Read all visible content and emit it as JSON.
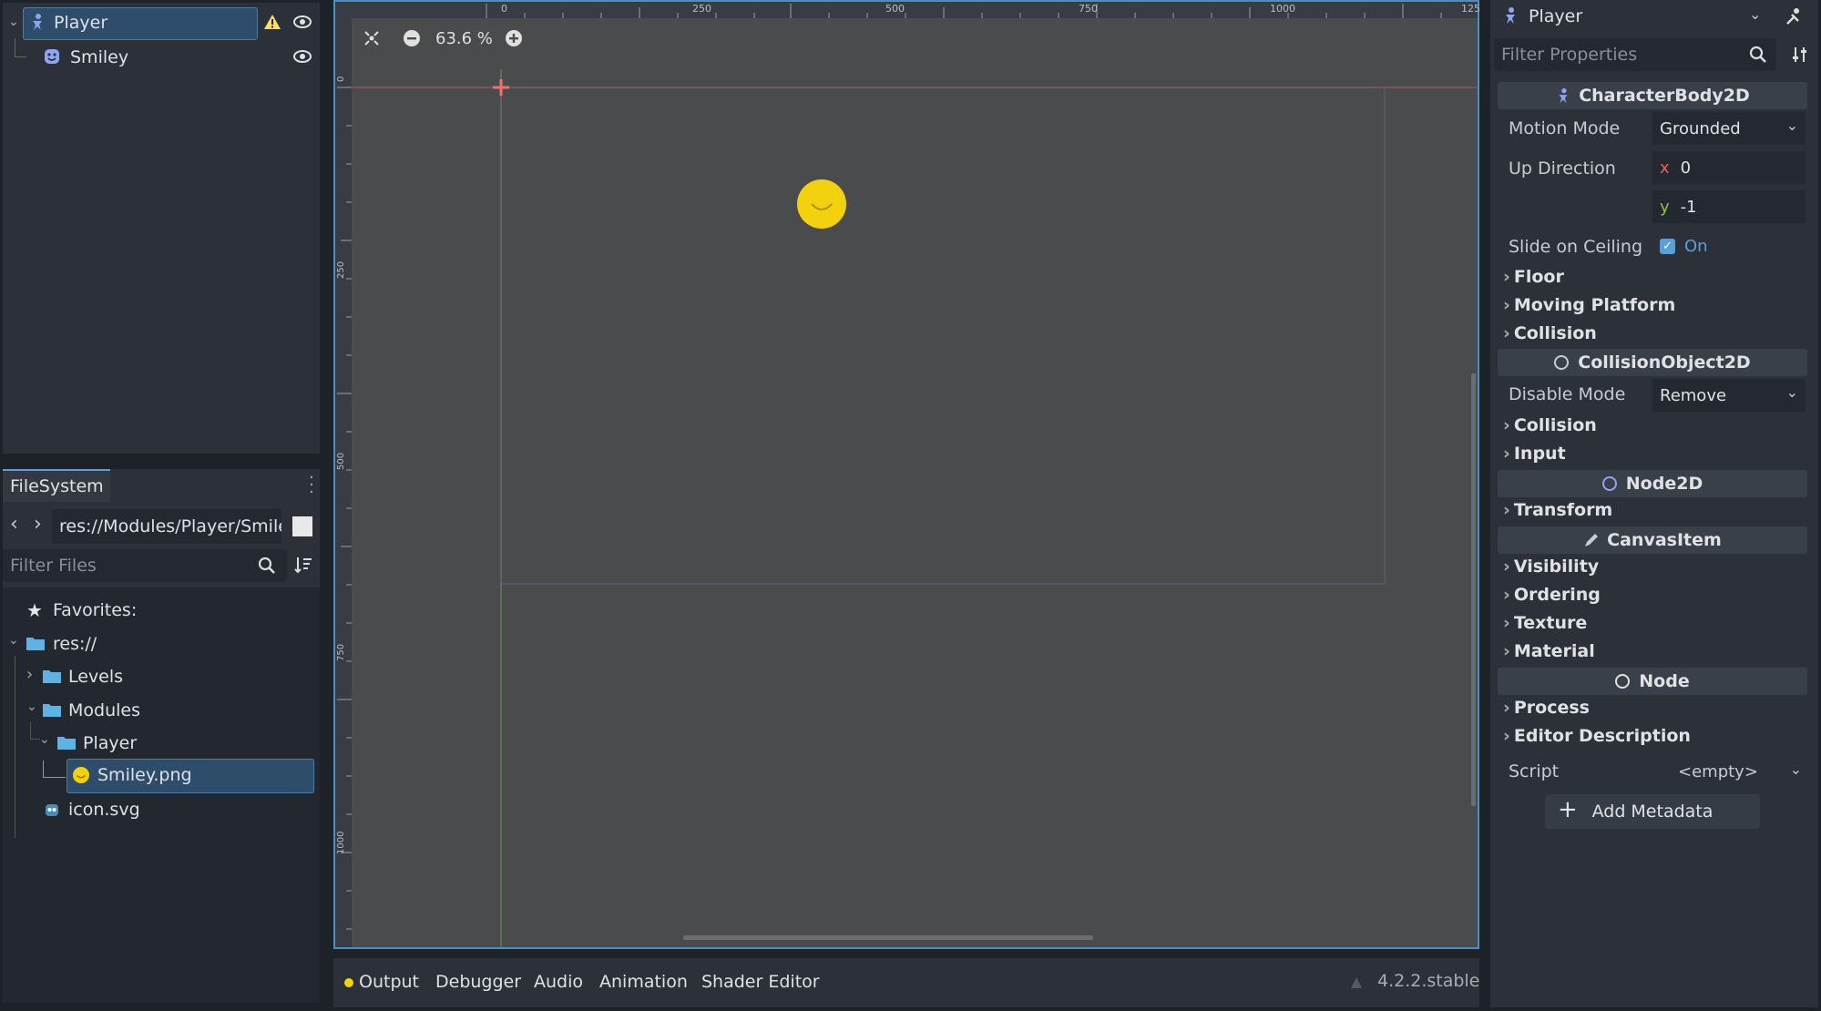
{
  "scene_tree": {
    "items": [
      {
        "label": "Player"
      },
      {
        "label": "Smiley"
      }
    ]
  },
  "filesystem": {
    "tab_label": "FileSystem",
    "path": "res://Modules/Player/Smile",
    "filter_placeholder": "Filter Files",
    "items": [
      {
        "label": "Favorites:"
      },
      {
        "label": "res://"
      },
      {
        "label": "Levels"
      },
      {
        "label": "Modules"
      },
      {
        "label": "Player"
      },
      {
        "label": "Smiley.png"
      },
      {
        "label": "icon.svg"
      }
    ]
  },
  "viewport": {
    "zoom": "63.6 %",
    "ruler_top": [
      "0",
      "250",
      "500",
      "750",
      "1000",
      "125"
    ],
    "ruler_left": [
      "0",
      "250",
      "500",
      "750",
      "1000"
    ]
  },
  "bottom_panel": {
    "tabs": [
      "Output",
      "Debugger",
      "Audio",
      "Animation",
      "Shader Editor"
    ],
    "version": "4.2.2.stable"
  },
  "inspector": {
    "node_name": "Player",
    "filter_placeholder": "Filter Properties",
    "sections": {
      "character_body": "CharacterBody2D",
      "collision_object": "CollisionObject2D",
      "node2d": "Node2D",
      "canvas_item": "CanvasItem",
      "node": "Node"
    },
    "motion_mode": {
      "label": "Motion Mode",
      "value": "Grounded"
    },
    "up_direction": {
      "label": "Up Direction",
      "x_label": "x",
      "x": "0",
      "y_label": "y",
      "y": "-1"
    },
    "slide_on_ceiling": {
      "label": "Slide on Ceiling",
      "value": "On"
    },
    "groups_cb": [
      "Floor",
      "Moving Platform",
      "Collision"
    ],
    "disable_mode": {
      "label": "Disable Mode",
      "value": "Remove"
    },
    "groups_co": [
      "Collision",
      "Input"
    ],
    "groups_n2d": [
      "Transform"
    ],
    "groups_ci": [
      "Visibility",
      "Ordering",
      "Texture",
      "Material"
    ],
    "groups_node": [
      "Process",
      "Editor Description"
    ],
    "script": {
      "label": "Script",
      "value": "<empty>"
    },
    "add_metadata": "Add Metadata"
  },
  "colors": {
    "accent": "#5b9fd8",
    "smiley": "#f2d20f",
    "warning": "#ffdd65"
  }
}
